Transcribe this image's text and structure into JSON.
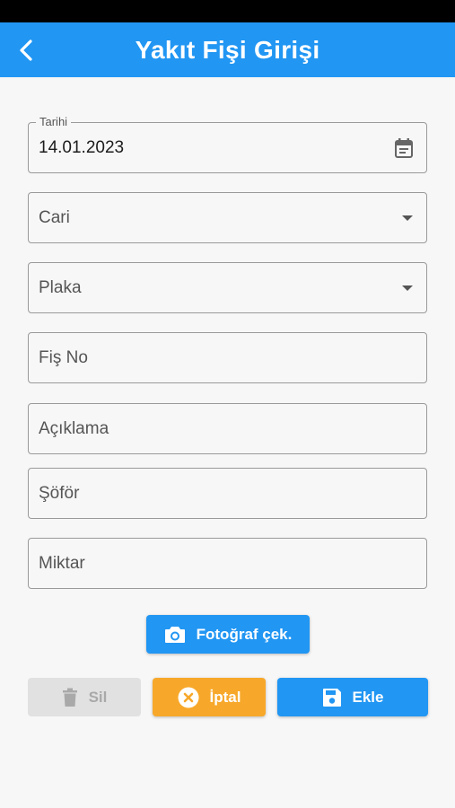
{
  "app_bar": {
    "title": "Yakıt Fişi Girişi"
  },
  "form": {
    "date": {
      "label": "Tarihi",
      "value": "14.01.2023"
    },
    "cari": {
      "placeholder": "Cari"
    },
    "plaka": {
      "placeholder": "Plaka"
    },
    "fis_no": {
      "placeholder": "Fiş No"
    },
    "aciklama": {
      "placeholder": "Açıklama"
    },
    "sofor": {
      "placeholder": "Şöför"
    },
    "miktar": {
      "placeholder": "Miktar"
    }
  },
  "buttons": {
    "photo": "Fotoğraf çek.",
    "delete": "Sil",
    "cancel": "İptal",
    "add": "Ekle"
  },
  "icons": {
    "back": "arrow-back-icon",
    "calendar": "calendar-icon",
    "dropdown": "dropdown-arrow-icon",
    "camera": "camera-icon",
    "delete": "trash-icon",
    "cancel": "cancel-circle-icon",
    "save": "save-icon"
  },
  "colors": {
    "primary": "#2196f3",
    "warning": "#f7a82a",
    "disabled": "#e1e1e1",
    "background": "#f7f7f7"
  }
}
